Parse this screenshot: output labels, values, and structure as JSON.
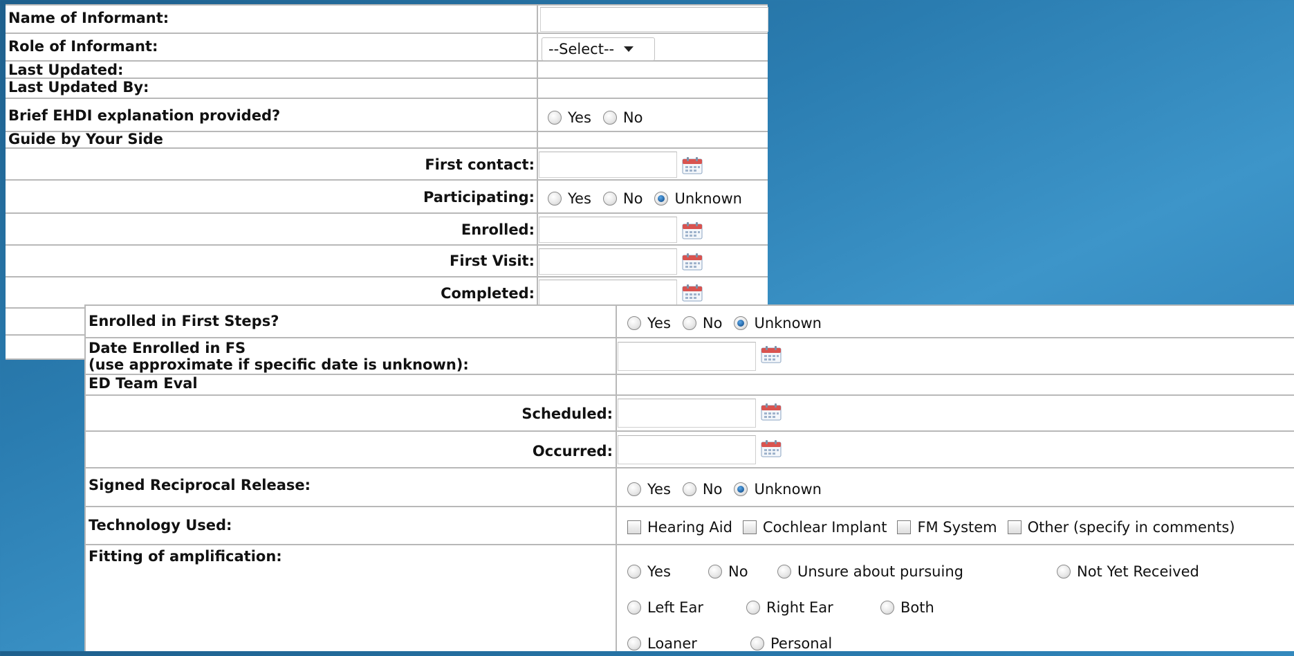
{
  "top_form": {
    "name_of_informant": {
      "label": "Name of Informant:",
      "value": ""
    },
    "role_of_informant": {
      "label": "Role of Informant:",
      "select_value": "--Select--"
    },
    "last_updated": {
      "label": "Last Updated:"
    },
    "last_updated_by": {
      "label": "Last Updated By:"
    },
    "brief_ehdi": {
      "label": "Brief EHDI explanation provided?",
      "options": [
        "Yes",
        "No"
      ],
      "selected": null
    },
    "guide_section": {
      "label": "Guide by Your Side"
    },
    "first_contact": {
      "label": "First contact:",
      "value": ""
    },
    "participating": {
      "label": "Participating:",
      "options": [
        "Yes",
        "No",
        "Unknown"
      ],
      "selected": "Unknown"
    },
    "enrolled": {
      "label": "Enrolled:",
      "value": ""
    },
    "first_visit": {
      "label": "First Visit:",
      "value": ""
    },
    "completed": {
      "label": "Completed:",
      "value": ""
    }
  },
  "bottom_form": {
    "enrolled_first_steps": {
      "label": "Enrolled in First Steps?",
      "options": [
        "Yes",
        "No",
        "Unknown"
      ],
      "selected": "Unknown"
    },
    "date_enrolled_fs": {
      "label_line1": "Date Enrolled in FS",
      "label_line2": "(use approximate if specific date is unknown):",
      "value": ""
    },
    "ed_team_eval": {
      "label": "ED Team Eval"
    },
    "scheduled": {
      "label": "Scheduled:",
      "value": ""
    },
    "occurred": {
      "label": "Occurred:",
      "value": ""
    },
    "signed_release": {
      "label": "Signed Reciprocal Release:",
      "options": [
        "Yes",
        "No",
        "Unknown"
      ],
      "selected": "Unknown"
    },
    "technology_used": {
      "label": "Technology Used:",
      "options": [
        "Hearing Aid",
        "Cochlear Implant",
        "FM System",
        "Other (specify in comments)"
      ]
    },
    "fitting": {
      "label": "Fitting of amplification:",
      "row1": [
        "Yes",
        "No",
        "Unsure about pursuing",
        "Not Yet Received"
      ],
      "row2": [
        "Left Ear",
        "Right Ear",
        "Both"
      ],
      "row3": [
        "Loaner",
        "Personal"
      ]
    }
  },
  "icons": {
    "calendar": "calendar-icon",
    "dropdown": "chevron-down-icon"
  },
  "colors": {
    "radio_selected": "#1f5f9e",
    "border": "#b8b8b8",
    "background_gradient": [
      "#1e5f8c",
      "#3d95c9"
    ]
  }
}
